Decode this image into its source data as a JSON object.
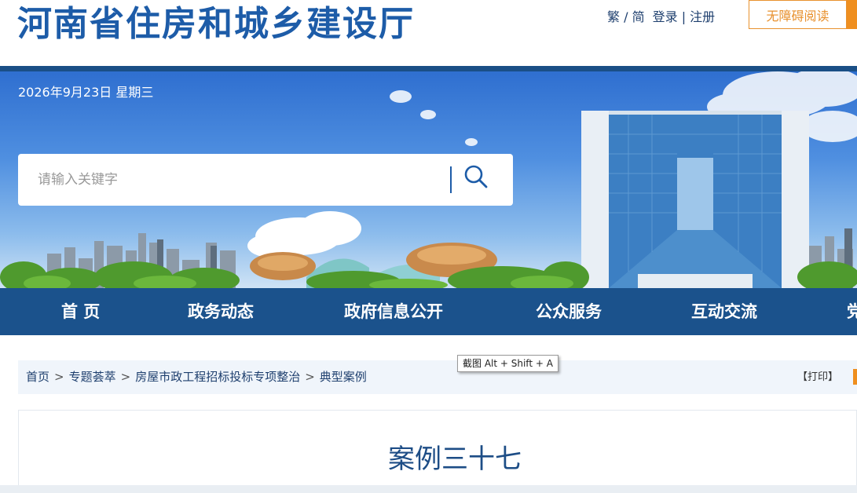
{
  "header": {
    "site_title": "河南省住房和城乡建设厅",
    "lang_trad": "繁",
    "lang_sep": " / ",
    "lang_simp": "简",
    "login": "登录",
    "auth_sep": " | ",
    "register": "注册",
    "accessibility": "无障碍阅读"
  },
  "banner": {
    "date": "2026年9月23日 星期三"
  },
  "search": {
    "placeholder": "请输入关键字",
    "icon": "search-icon"
  },
  "nav": {
    "items": [
      {
        "label": "首 页"
      },
      {
        "label": "政务动态"
      },
      {
        "label": "政府信息公开"
      },
      {
        "label": "公众服务"
      },
      {
        "label": "互动交流"
      },
      {
        "label": "党"
      }
    ]
  },
  "breadcrumb": {
    "items": [
      "首页",
      "专题荟萃",
      "房屋市政工程招标投标专项整治",
      "典型案例"
    ],
    "separator": ">",
    "print": "【打印】"
  },
  "tooltip": {
    "text": "截图 Alt + Shift + A"
  },
  "article": {
    "title": "案例三十七"
  },
  "colors": {
    "brand_blue": "#1d5ca8",
    "nav_blue": "#1b528c",
    "accent_orange": "#ef8f1f"
  }
}
